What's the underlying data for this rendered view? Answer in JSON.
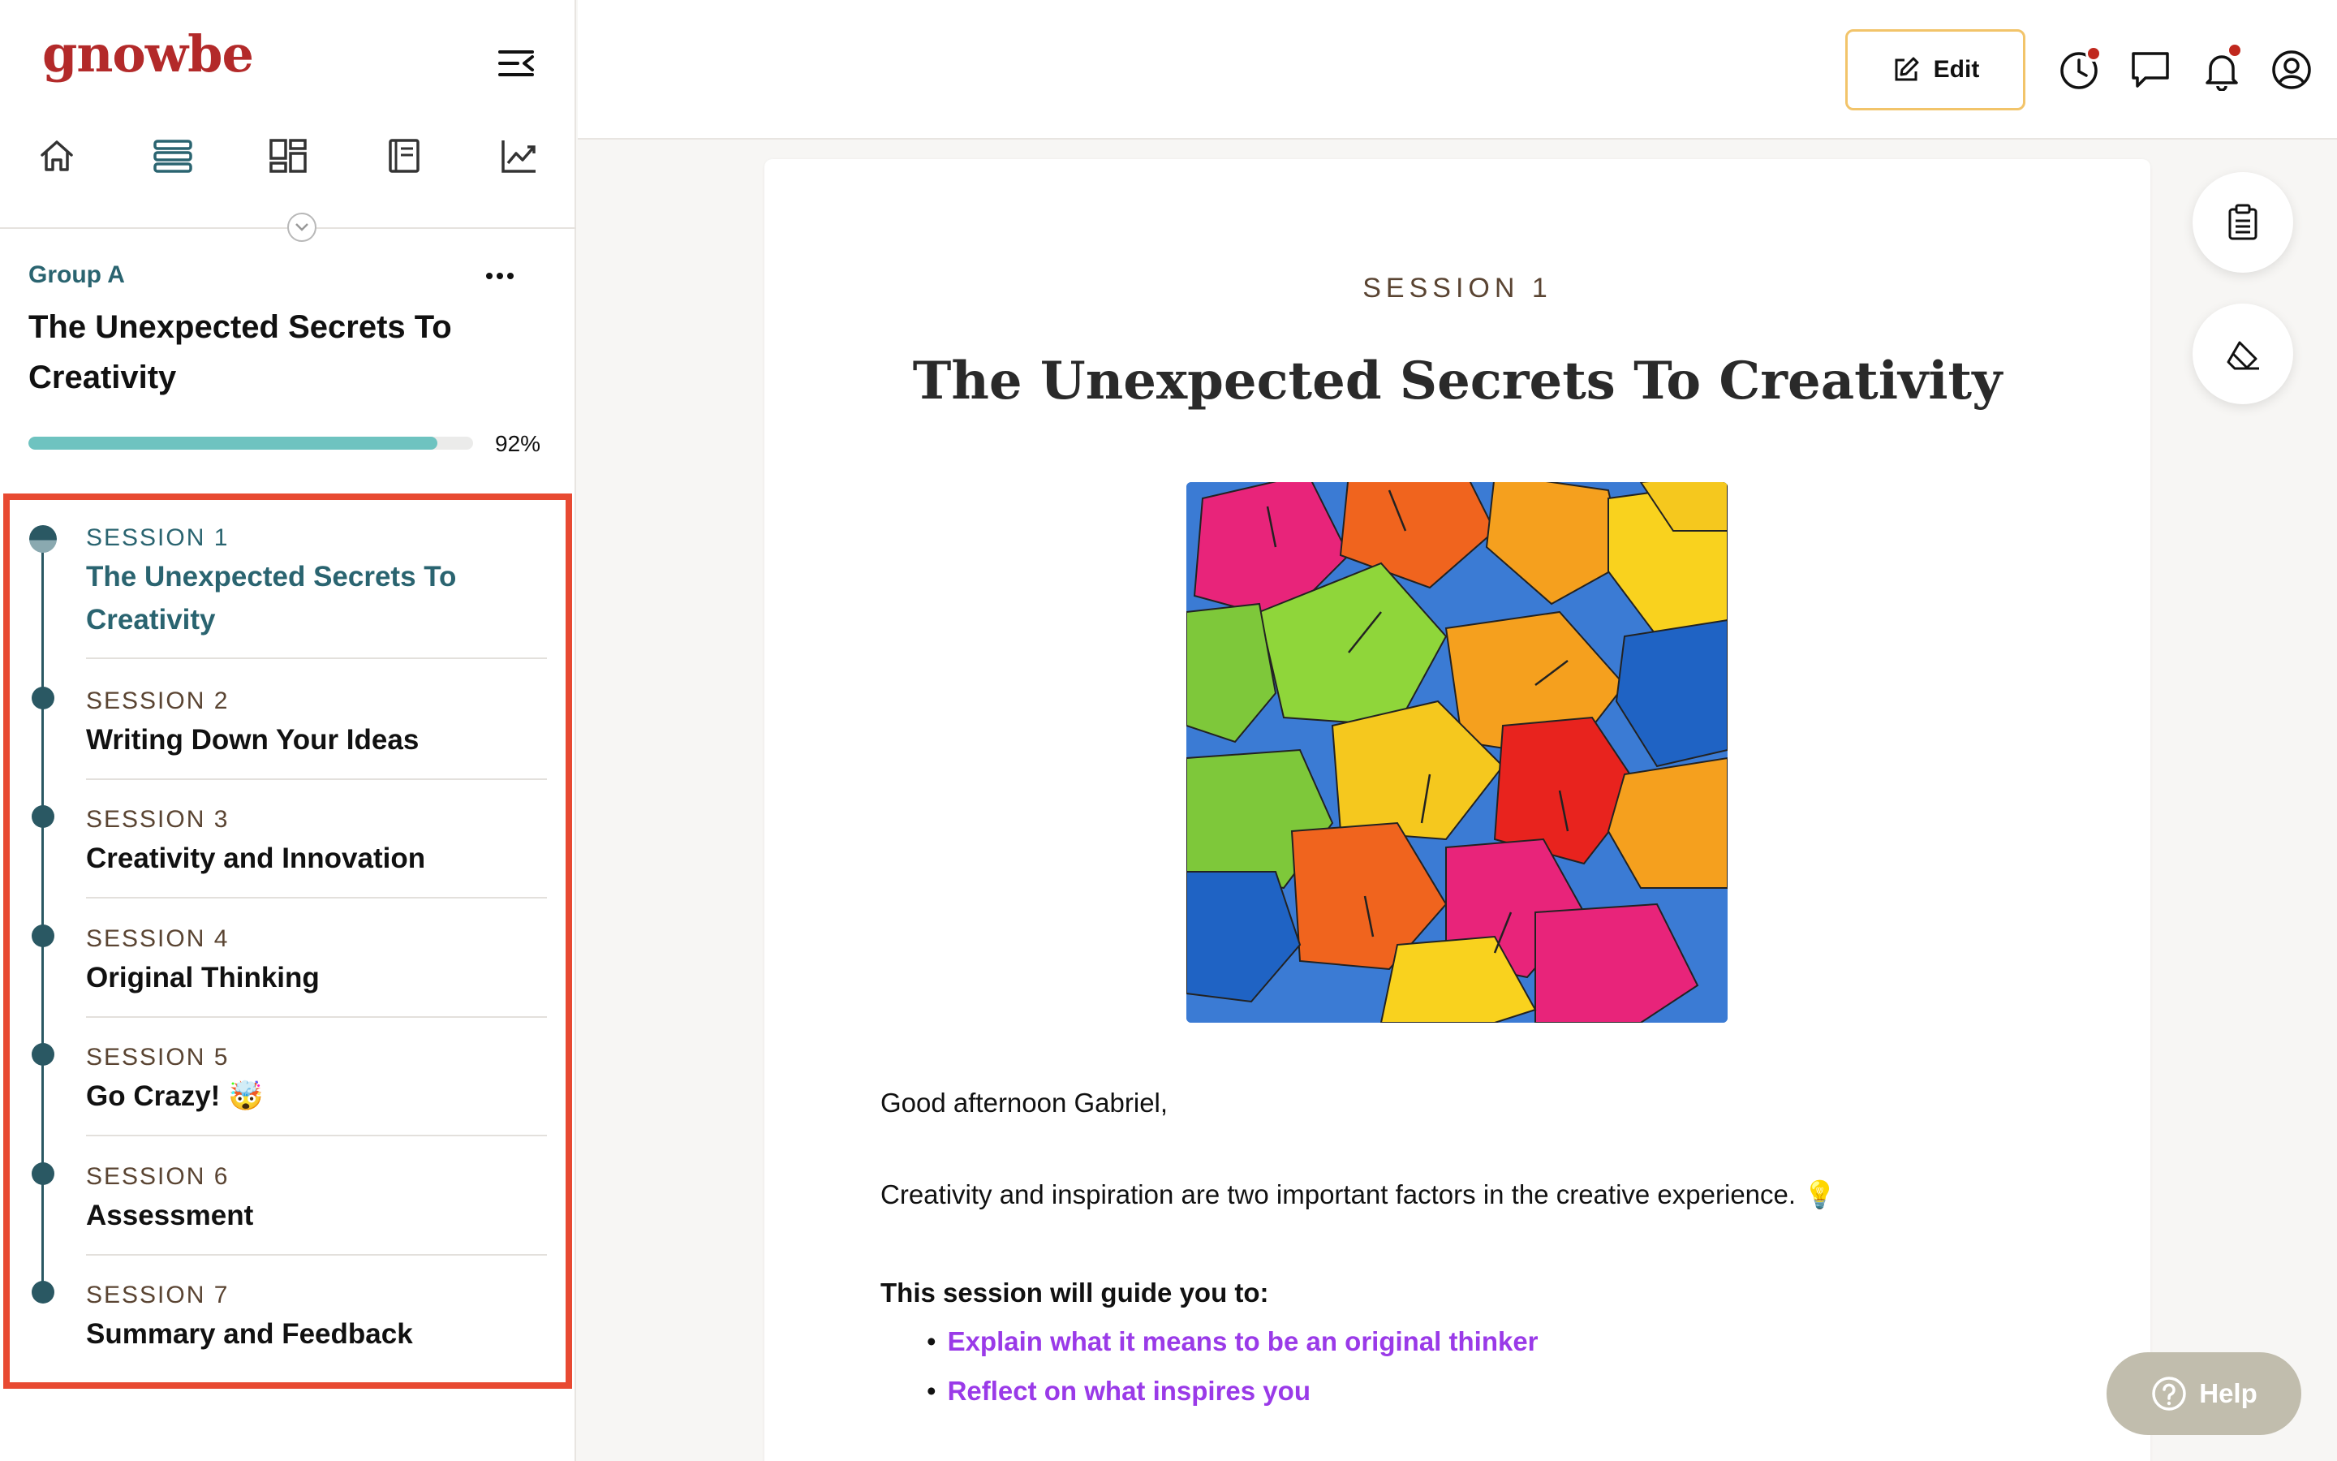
{
  "app": {
    "logo_text": "gnowbe"
  },
  "sidebar": {
    "nav_icons": [
      "home-icon",
      "list-icon",
      "dashboard-icon",
      "book-icon",
      "analytics-icon"
    ],
    "group_label": "Group A",
    "course_title": "The Unexpected Secrets To Creativity",
    "progress_percent": 92,
    "progress_label": "92%",
    "sessions": [
      {
        "number_label": "SESSION 1",
        "title": "The Unexpected Secrets To Creativity",
        "current": true
      },
      {
        "number_label": "SESSION 2",
        "title": "Writing Down Your Ideas",
        "current": false
      },
      {
        "number_label": "SESSION 3",
        "title": "Creativity and Innovation",
        "current": false
      },
      {
        "number_label": "SESSION 4",
        "title": "Original Thinking",
        "current": false
      },
      {
        "number_label": "SESSION 5",
        "title": "Go Crazy! 🤯",
        "current": false
      },
      {
        "number_label": "SESSION 6",
        "title": "Assessment",
        "current": false
      },
      {
        "number_label": "SESSION 7",
        "title": "Summary and Feedback",
        "current": false
      }
    ],
    "highlight_color": "#e84a32"
  },
  "topbar": {
    "edit_label": "Edit",
    "icons": [
      "history-icon",
      "chat-icon",
      "bell-icon",
      "profile-icon"
    ],
    "notification_color": "#c0281e"
  },
  "content": {
    "session_label": "SESSION 1",
    "title": "The Unexpected Secrets To Creativity",
    "image_description_icon": "umbrellas-image",
    "greeting": "Good afternoon Gabriel,",
    "intro": "Creativity and inspiration are two important factors in the creative experience. 💡",
    "guide_heading": "This session will guide you to:",
    "bullets": [
      "Explain what it means to be an original thinker",
      "Reflect on what inspires you"
    ],
    "link_color": "#9a3ae8"
  },
  "floating": {
    "actions": [
      "clipboard-icon",
      "eraser-icon"
    ],
    "help_label": "Help"
  },
  "colors": {
    "brand": "#b32a2a",
    "teal": "#2a6470",
    "progress": "#6ec3c0",
    "edit_border": "#f2c46a"
  }
}
